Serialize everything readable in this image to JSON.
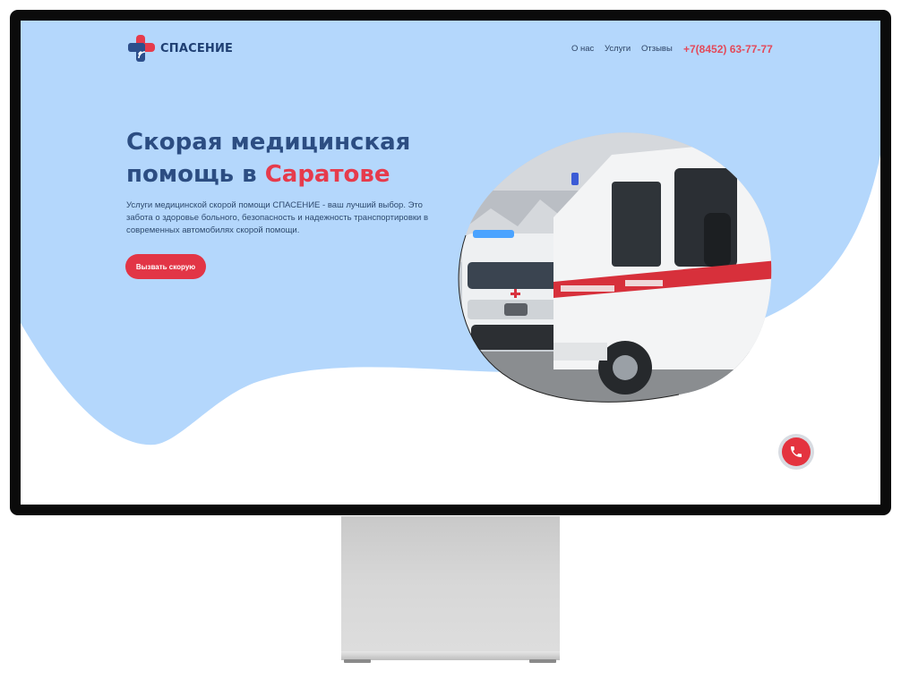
{
  "brand": {
    "name": "СПАСЕНИЕ",
    "logo_icon": "cross-signal-logo-icon"
  },
  "nav": {
    "items": [
      "О нас",
      "Услуги",
      "Отзывы"
    ],
    "phone": "+7(8452) 63-77-77"
  },
  "hero": {
    "title_line1": "Скорая медицинская",
    "title_line2_prefix": "помощь в ",
    "title_line2_accent": "Саратове",
    "description": "Услуги медицинской скорой помощи СПАСЕНИЕ - ваш лучший выбор. Это забота о здоровье больного, безопасность и надежность транспортировки в современных автомобилях скорой помощи.",
    "cta_label": "Вызвать скорую",
    "image_subject": "ambulance-vehicles-photo",
    "vehicle_stripe_text": "СКОРАЯ МЕДИЦИНСКАЯ ПОМОЩЬ"
  },
  "floating": {
    "call_icon": "phone-icon"
  },
  "colors": {
    "hero_bg": "#b4d7fc",
    "title": "#2c4d82",
    "accent": "#e63b4c",
    "button": "#e23546",
    "phone": "#e34a5b"
  }
}
